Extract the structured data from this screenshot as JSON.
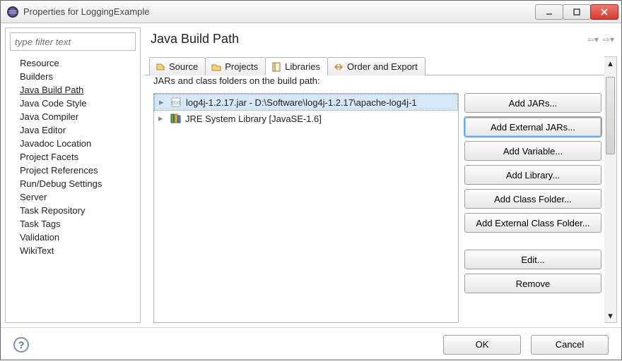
{
  "window": {
    "title": "Properties for LoggingExample"
  },
  "sidebar": {
    "filter_placeholder": "type filter text",
    "items": [
      "Resource",
      "Builders",
      "Java Build Path",
      "Java Code Style",
      "Java Compiler",
      "Java Editor",
      "Javadoc Location",
      "Project Facets",
      "Project References",
      "Run/Debug Settings",
      "Server",
      "Task Repository",
      "Task Tags",
      "Validation",
      "WikiText"
    ],
    "selected_index": 2
  },
  "page": {
    "title": "Java Build Path"
  },
  "tabs": {
    "items": [
      "Source",
      "Projects",
      "Libraries",
      "Order and Export"
    ],
    "active_index": 2
  },
  "libraries": {
    "caption": "JARs and class folders on the build path:",
    "rows": [
      {
        "label": "log4j-1.2.17.jar - D:\\Software\\log4j-1.2.17\\apache-log4j-1",
        "icon": "jar"
      },
      {
        "label": "JRE System Library [JavaSE-1.6]",
        "icon": "library"
      }
    ],
    "selected_index": 0
  },
  "buttons": {
    "add_jars": "Add JARs...",
    "add_external_jars": "Add External JARs...",
    "add_variable": "Add Variable...",
    "add_library": "Add Library...",
    "add_class_folder": "Add Class Folder...",
    "add_external_class_folder": "Add External Class Folder...",
    "edit": "Edit...",
    "remove": "Remove"
  },
  "footer": {
    "ok": "OK",
    "cancel": "Cancel"
  }
}
